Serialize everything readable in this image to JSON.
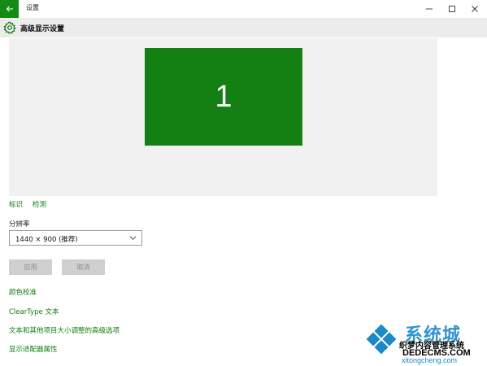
{
  "window": {
    "title": "设置",
    "back_icon": "back-arrow-icon",
    "minimize_icon": "minimize-icon",
    "maximize_icon": "maximize-icon",
    "close_icon": "close-icon",
    "accent": "#138a13"
  },
  "header": {
    "icon": "gear-icon",
    "title": "高级显示设置"
  },
  "preview": {
    "monitor_number": "1",
    "monitor_color": "#148014"
  },
  "actions": {
    "identify": "标识",
    "detect": "检测"
  },
  "resolution": {
    "label": "分辨率",
    "selected": "1440 × 900 (推荐)"
  },
  "buttons": {
    "apply": "应用",
    "cancel": "取消"
  },
  "links": [
    "颜色校准",
    "ClearType 文本",
    "文本和其他项目大小调整的高级选项",
    "显示适配器属性"
  ],
  "watermark": {
    "big_text": "系统城",
    "line1": "织梦内容管理系统",
    "domain": "DEDECMS.COM",
    "url": "xitongcheng.com"
  }
}
